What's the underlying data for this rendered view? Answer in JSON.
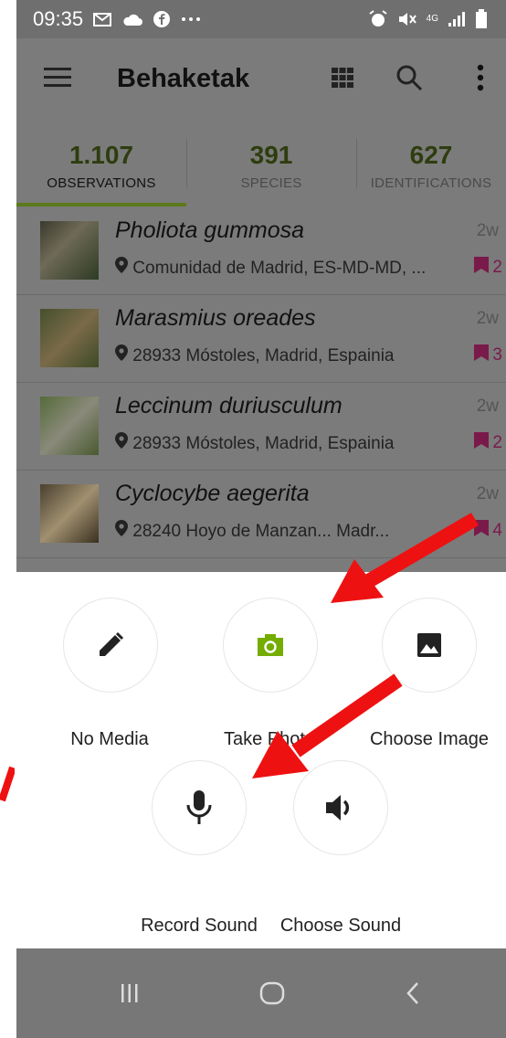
{
  "status": {
    "time": "09:35",
    "left_icons": [
      "gmail-icon",
      "cloud-icon",
      "facebook-icon",
      "more-icon"
    ],
    "right_icons": [
      "alarm-icon",
      "mute-icon",
      "signal-4g-icon",
      "battery-icon"
    ],
    "network": "4G"
  },
  "appbar": {
    "title": "Behaketak"
  },
  "tabs": [
    {
      "count": "1.107",
      "label": "OBSERVATIONS",
      "active": true
    },
    {
      "count": "391",
      "label": "SPECIES",
      "active": false
    },
    {
      "count": "627",
      "label": "IDENTIFICATIONS",
      "active": false
    }
  ],
  "observations": [
    {
      "species": "Pholiota gummosa",
      "location": "Comunidad de Madrid, ES-MD-MD, ...",
      "age": "2w",
      "count": "2"
    },
    {
      "species": "Marasmius oreades",
      "location": "28933 Móstoles, Madrid, Espainia",
      "age": "2w",
      "count": "3"
    },
    {
      "species": "Leccinum duriusculum",
      "location": "28933 Móstoles, Madrid, Espainia",
      "age": "2w",
      "count": "2"
    },
    {
      "species": "Cyclocybe aegerita",
      "location": "28240 Hoyo de Manzan... Madr...",
      "age": "2w",
      "count": "4"
    }
  ],
  "sheet": {
    "options": [
      {
        "label": "No Media",
        "icon": "pencil-icon"
      },
      {
        "label": "Take Photo",
        "icon": "camera-icon"
      },
      {
        "label": "Choose Image",
        "icon": "image-icon"
      },
      {
        "label": "Record Sound",
        "icon": "microphone-icon"
      },
      {
        "label": "Choose Sound",
        "icon": "speaker-icon"
      }
    ]
  },
  "colors": {
    "accent_green": "#74ac00",
    "annotation_arrow": "#ee1111",
    "overlay": "#7b7b7b"
  }
}
